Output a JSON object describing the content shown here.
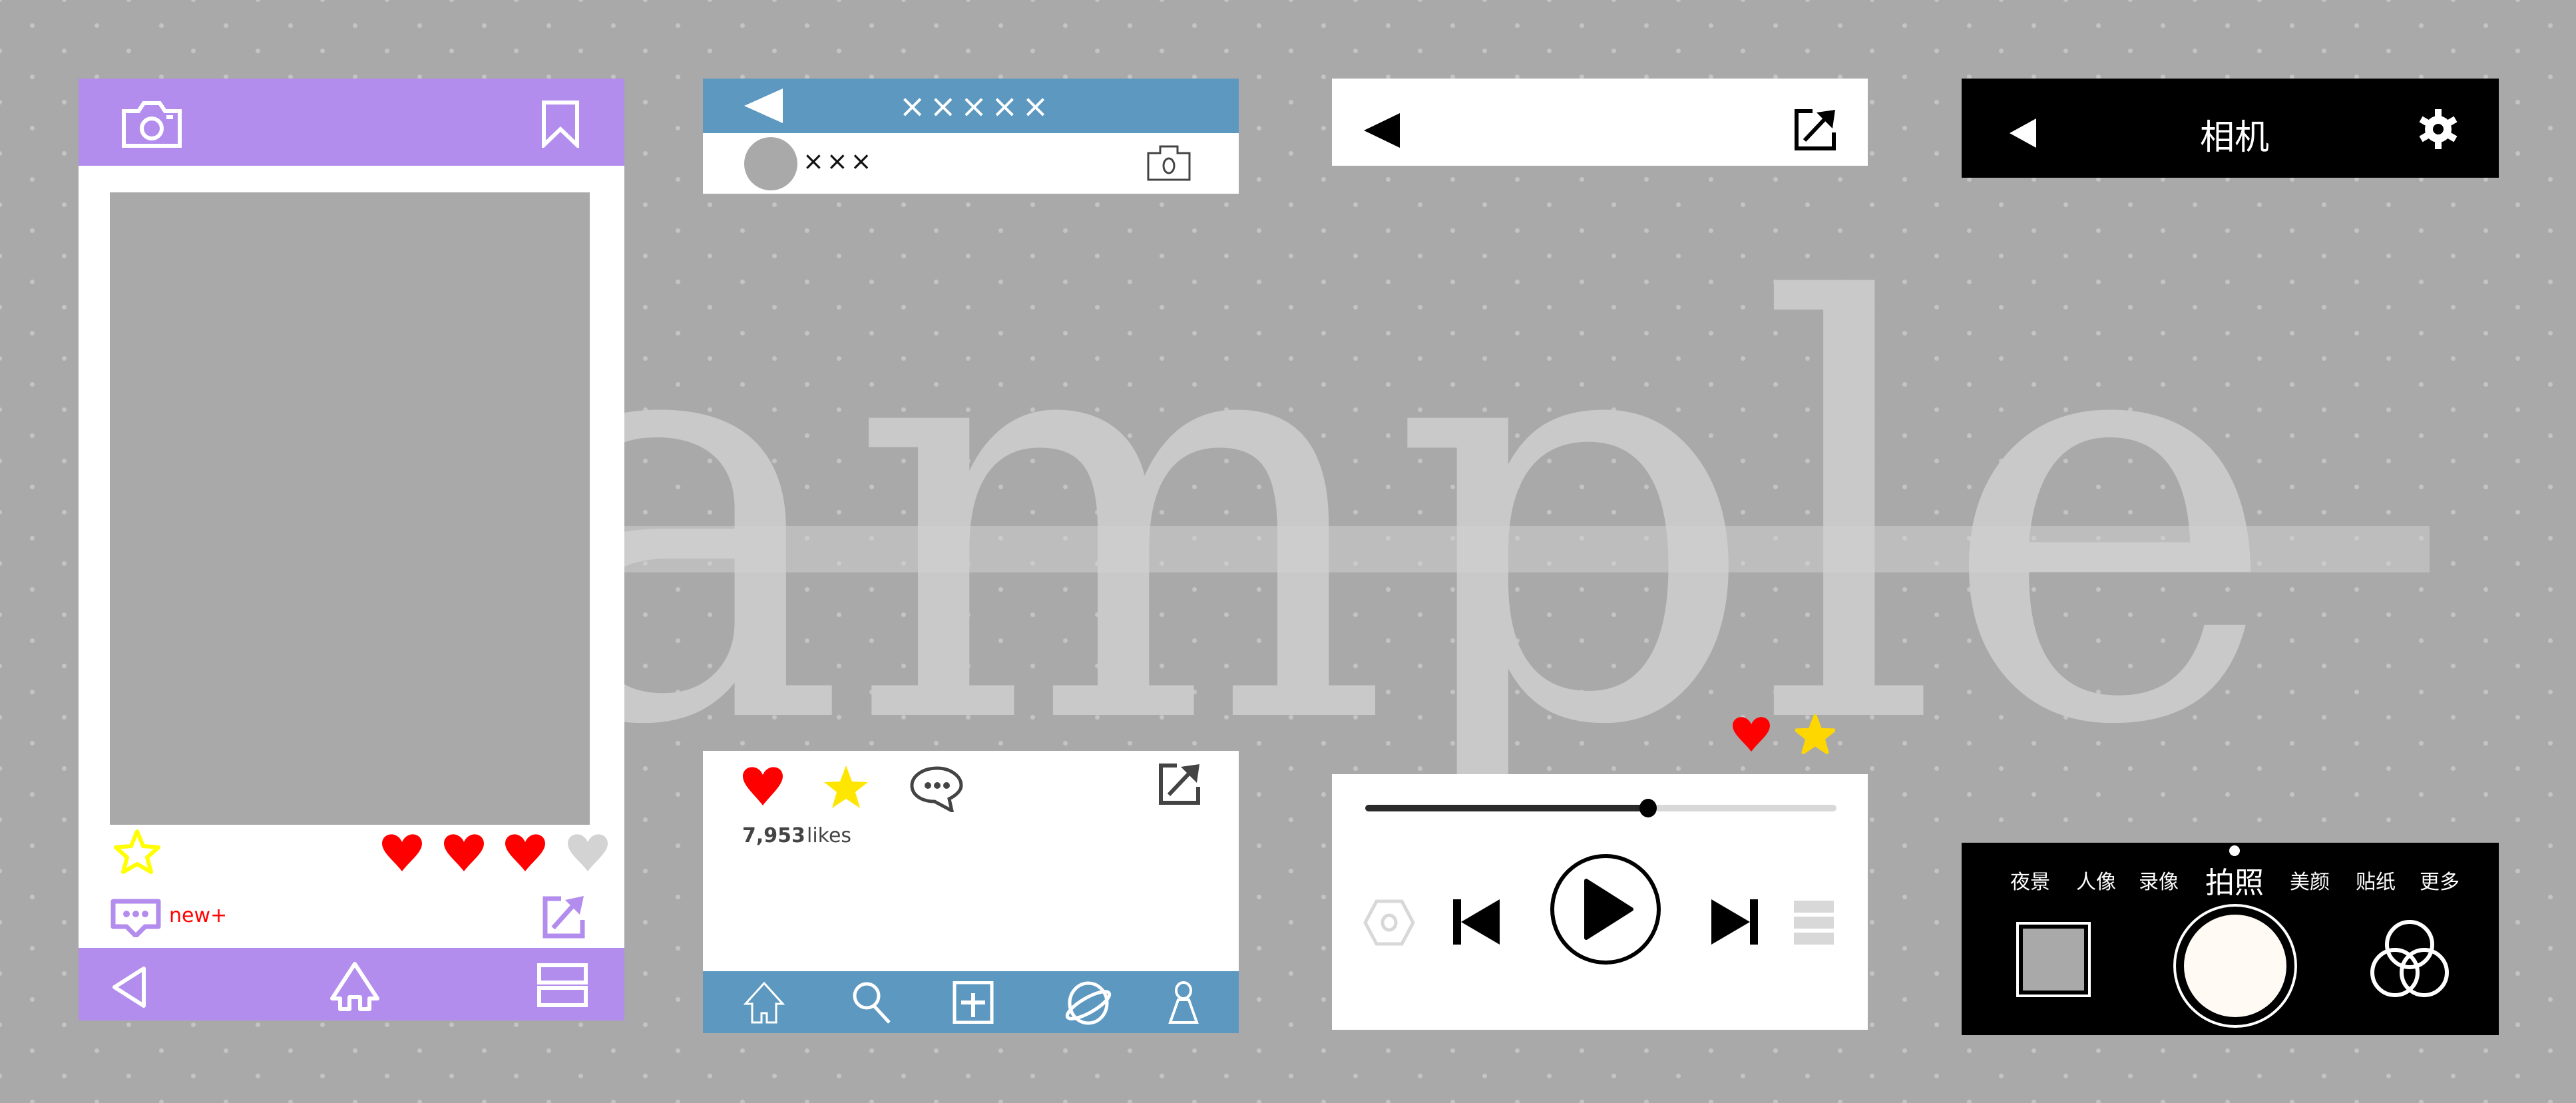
{
  "watermark": "sample",
  "colors": {
    "background": "#a9a9a9",
    "purple": "#b38ded",
    "blue": "#5d98c1",
    "black": "#000000",
    "heart_red": "#ff0000",
    "star_yellow": "#ffe600",
    "heart_inactive": "#d3d3d3"
  },
  "panel1": {
    "rating_hearts_filled": 3,
    "rating_hearts_total": 4,
    "new_badge": "new+"
  },
  "panel2": {
    "header_title": "×××××",
    "username": "×××",
    "likes_count": "7,953",
    "likes_label": "likes"
  },
  "panel3": {
    "progress": 0.6
  },
  "panel4": {
    "title": "相机",
    "modes": [
      "夜景",
      "人像",
      "录像",
      "拍照",
      "美颜",
      "贴纸",
      "更多"
    ],
    "selected_mode": "拍照"
  }
}
